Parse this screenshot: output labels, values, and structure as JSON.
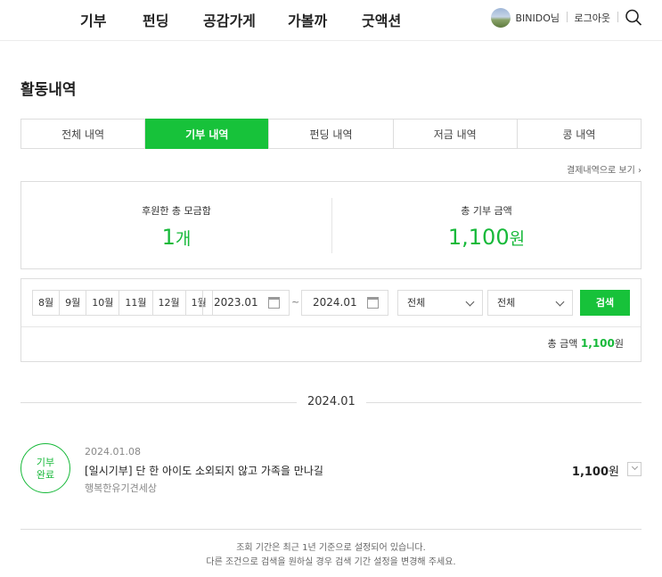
{
  "nav": {
    "items": [
      "기부",
      "펀딩",
      "공감가게",
      "가볼까",
      "굿액션"
    ]
  },
  "user": {
    "name": "BINIDO님",
    "logout": "로그아웃"
  },
  "icons": {
    "search": "search-icon",
    "calendar": "calendar-icon",
    "chevron": "chevron-down-icon"
  },
  "colors": {
    "accent": "#17c23a",
    "value_green": "#17b93a"
  },
  "page_title": "활동내역",
  "tabs": [
    {
      "label": "전체 내역",
      "active": false
    },
    {
      "label": "기부 내역",
      "active": true
    },
    {
      "label": "펀딩 내역",
      "active": false
    },
    {
      "label": "저금 내역",
      "active": false
    },
    {
      "label": "콩 내역",
      "active": false
    }
  ],
  "receipt_link": "결제내역으로 보기",
  "summary": {
    "count_label": "후원한 총 모금함",
    "count_value": "1",
    "count_unit": "개",
    "amount_label": "총 기부 금액",
    "amount_value": "1,100",
    "amount_unit": "원"
  },
  "filter": {
    "months": [
      "8월",
      "9월",
      "10월",
      "11월",
      "12월",
      "1월"
    ],
    "start_date": "2023.01",
    "tilde": "~",
    "end_date": "2024.01",
    "select1": "전체",
    "select2": "전체",
    "search_button": "검색",
    "total_label": "총 금액",
    "total_value": "1,100",
    "total_unit": "원"
  },
  "month_group": "2024.01",
  "donation": {
    "badge_line1": "기부",
    "badge_line2": "완료",
    "date": "2024.01.08",
    "title": "[일시기부] 단 한 아이도 소외되지 않고 가족을 만나길",
    "org": "행복한유기견세상",
    "amount_value": "1,100",
    "amount_unit": "원"
  },
  "notice": {
    "line1": "조회 기간은 최근 1년 기준으로 설정되어 있습니다.",
    "line2": "다른 조건으로 검색을 원하실 경우 검색 기간 설정을 변경해 주세요."
  }
}
